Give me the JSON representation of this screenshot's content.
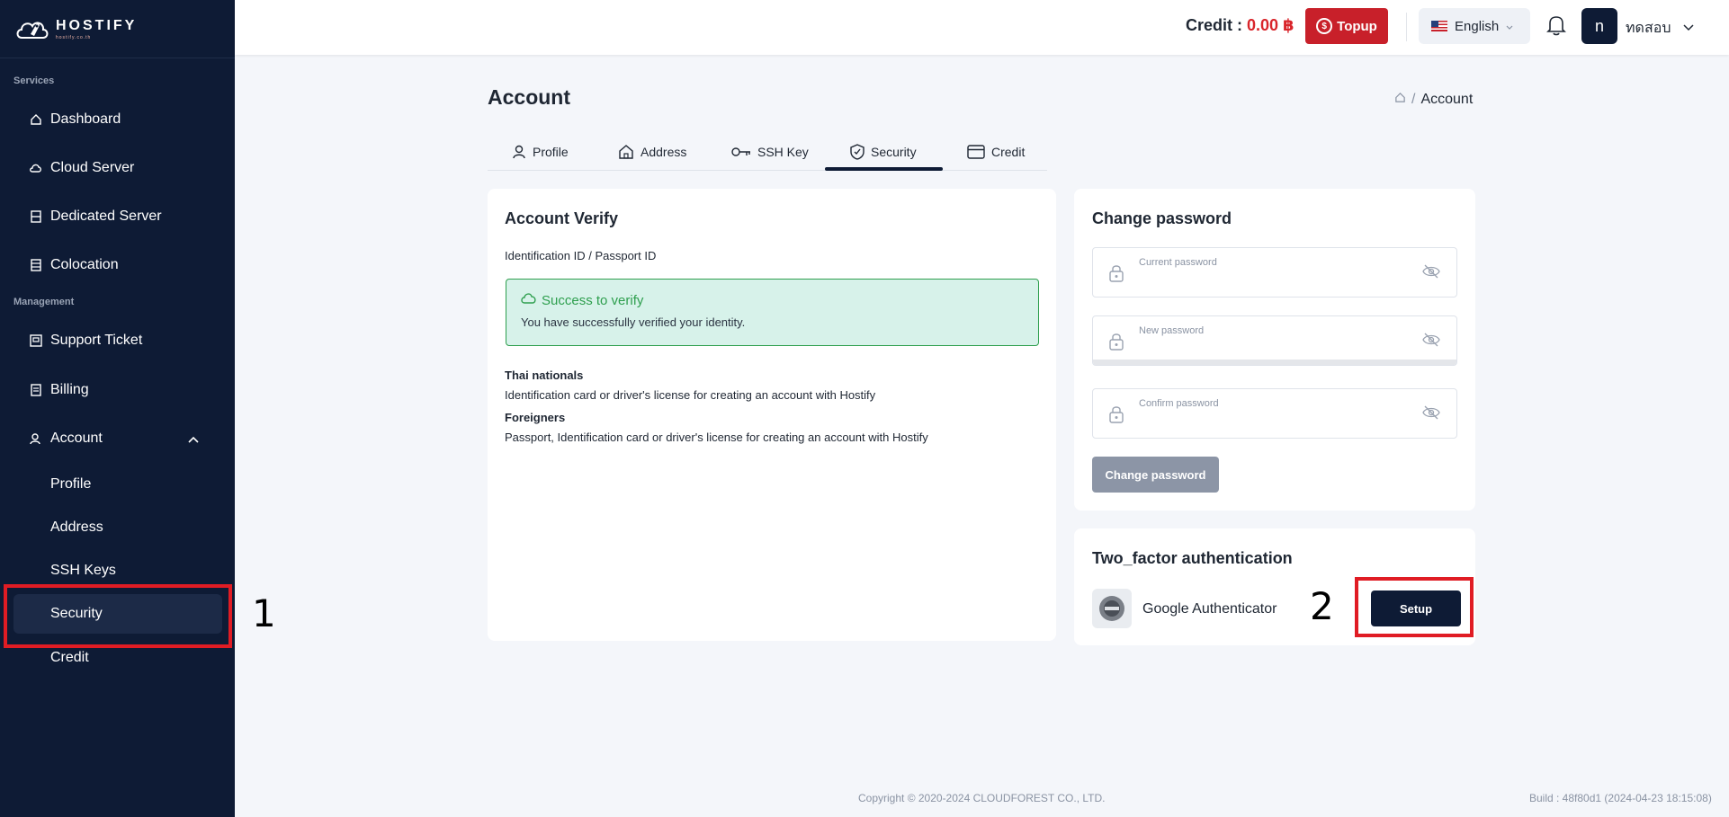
{
  "brand": {
    "name": "HOSTIFY",
    "tagline": "hostify.co.th"
  },
  "sidebar": {
    "section_services": "Services",
    "section_management": "Management",
    "items": [
      {
        "label": "Dashboard",
        "icon": "home-icon"
      },
      {
        "label": "Cloud Server",
        "icon": "cloud-icon"
      },
      {
        "label": "Dedicated Server",
        "icon": "server-icon"
      },
      {
        "label": "Colocation",
        "icon": "rack-icon"
      },
      {
        "label": "Support Ticket",
        "icon": "ticket-icon"
      },
      {
        "label": "Billing",
        "icon": "billing-icon"
      },
      {
        "label": "Account",
        "icon": "account-icon"
      }
    ],
    "account_sub": [
      "Profile",
      "Address",
      "SSH Keys",
      "Security",
      "Credit"
    ],
    "active": "Security"
  },
  "header": {
    "credit_label": "Credit : ",
    "credit_amount": "0.00 ฿",
    "topup_label": "Topup",
    "language": "English",
    "avatar_letter": "n",
    "username": "ทดสอบ"
  },
  "page": {
    "title": "Account",
    "breadcrumb_current": "Account",
    "tabs": [
      "Profile",
      "Address",
      "SSH Key",
      "Security",
      "Credit"
    ],
    "active_tab": "Security"
  },
  "verify": {
    "title": "Account Verify",
    "id_label": "Identification ID / Passport ID",
    "success_title": "Success to verify",
    "success_desc": "You have successfully verified your identity.",
    "thai_title": "Thai nationals",
    "thai_desc": "Identification card or driver's license for creating an account with Hostify",
    "foreign_title": "Foreigners",
    "foreign_desc": "Passport, Identification card or driver's license for creating an account with Hostify"
  },
  "password": {
    "title": "Change password",
    "current_placeholder": "Current password",
    "new_placeholder": "New password",
    "confirm_placeholder": "Confirm password",
    "button": "Change password"
  },
  "twofa": {
    "title": "Two_factor authentication",
    "provider": "Google Authenticator",
    "button": "Setup"
  },
  "annotations": {
    "one": "1",
    "two": "2"
  },
  "footer": {
    "copyright": "Copyright © 2020-2024 CLOUDFOREST CO., LTD.",
    "build": "Build : 48f80d1 (2024-04-23 18:15:08)"
  },
  "colors": {
    "sidebar": "#0e1b35",
    "accent_red": "#c8202a",
    "success": "#2e9f4e",
    "annotation": "#e01c24"
  }
}
